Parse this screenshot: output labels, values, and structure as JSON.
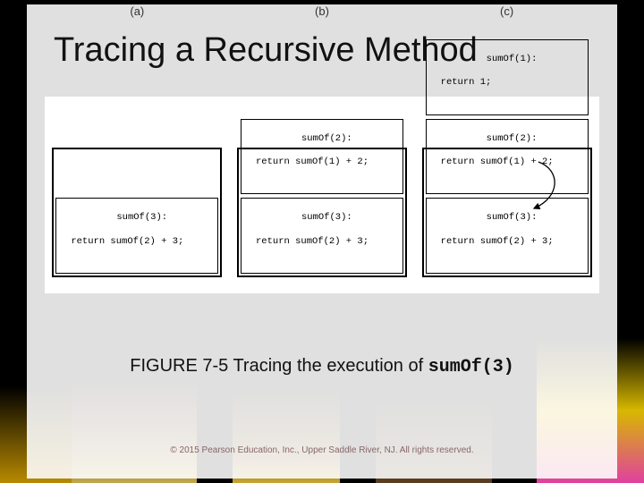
{
  "title": "Tracing a Recursive Method",
  "figure": {
    "panels": {
      "a": {
        "label": "(a)",
        "frames": [
          {
            "call": "sumOf(3):",
            "ret": "return sumOf(2) + 3;"
          }
        ]
      },
      "b": {
        "label": "(b)",
        "frames": [
          {
            "call": "sumOf(2):",
            "ret": "return sumOf(1) + 2;"
          },
          {
            "call": "sumOf(3):",
            "ret": "return sumOf(2) + 3;"
          }
        ]
      },
      "c": {
        "label": "(c)",
        "frames": [
          {
            "call": "sumOf(1):",
            "ret": "return 1;"
          },
          {
            "call": "sumOf(2):",
            "ret": "return sumOf(1) + 2;"
          },
          {
            "call": "sumOf(3):",
            "ret": "return sumOf(2) + 3;"
          }
        ]
      }
    }
  },
  "caption_prefix": "FIGURE 7-5 Tracing the execution of ",
  "caption_code": "sumOf(3)",
  "copyright": "© 2015 Pearson Education, Inc., Upper Saddle River, NJ.  All rights reserved."
}
